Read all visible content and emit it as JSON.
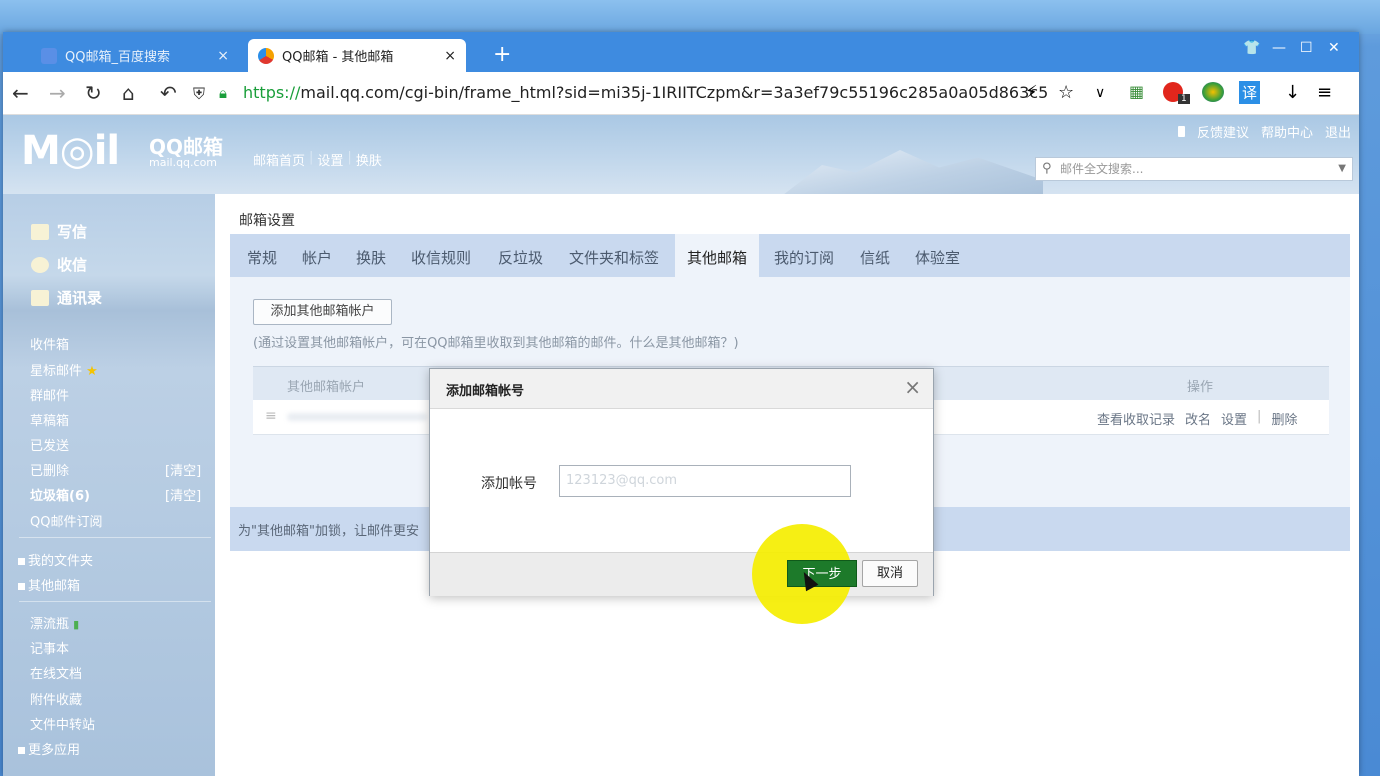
{
  "browser": {
    "tabs": [
      {
        "title": "QQ邮箱_百度搜索",
        "close": "×"
      },
      {
        "title": "QQ邮箱 - 其他邮箱",
        "close": "×"
      }
    ],
    "new_tab": "+",
    "window_controls": {
      "skin": "👕",
      "minimize": "—",
      "maximize": "☐",
      "close": "✕"
    },
    "url_scheme": "https://",
    "url_rest": "mail.qq.com/cgi-bin/frame_html?sid=mi35j-1IRIITCzpm&r=3a3ef79c55196c285a0a05d863c5",
    "ext_badge": "1",
    "translate_label": "译"
  },
  "mail": {
    "logo": "M◎il",
    "logo_sub": "QQ邮箱",
    "logo_url": "mail.qq.com",
    "topnav": [
      "邮箱首页",
      "设置",
      "换肤"
    ],
    "toplinks": [
      "反馈建议",
      "帮助中心",
      "退出"
    ],
    "search_placeholder": "邮件全文搜索...",
    "sidebar": {
      "primary": [
        "写信",
        "收信",
        "通讯录"
      ],
      "folders": [
        "收件箱",
        "星标邮件",
        "群邮件",
        "草稿箱",
        "已发送",
        "已删除",
        "垃圾箱(6)",
        "QQ邮件订阅"
      ],
      "clear_label": "[清空]",
      "groups": [
        "我的文件夹",
        "其他邮箱"
      ],
      "apps": [
        "漂流瓶",
        "记事本",
        "在线文档",
        "附件收藏",
        "文件中转站"
      ],
      "more": "更多应用"
    },
    "content_title": "邮箱设置",
    "settings_tabs": [
      "常规",
      "帐户",
      "换肤",
      "收信规则",
      "反垃圾",
      "文件夹和标签",
      "其他邮箱",
      "我的订阅",
      "信纸",
      "体验室"
    ],
    "add_account_button": "添加其他邮箱帐户",
    "hint": "(通过设置其他邮箱帐户，可在QQ邮箱里收取到其他邮箱的邮件。什么是其他邮箱？)",
    "table": {
      "col_account": "其他邮箱帐户",
      "col_actions": "操作",
      "row_actions": [
        "查看收取记录",
        "改名",
        "设置",
        "|",
        "删除"
      ]
    },
    "bottom_note": "为\"其他邮箱\"加锁，让邮件更安"
  },
  "dialog": {
    "title": "添加邮箱帐号",
    "close": "×",
    "field_label": "添加帐号",
    "field_value": "123123@qq.com",
    "next_button": "下一步",
    "cancel_button": "取消"
  },
  "colors": {
    "tabbar": "#3e8be0",
    "active_green": "#1d7a2a",
    "highlight": "#f5ee00"
  }
}
